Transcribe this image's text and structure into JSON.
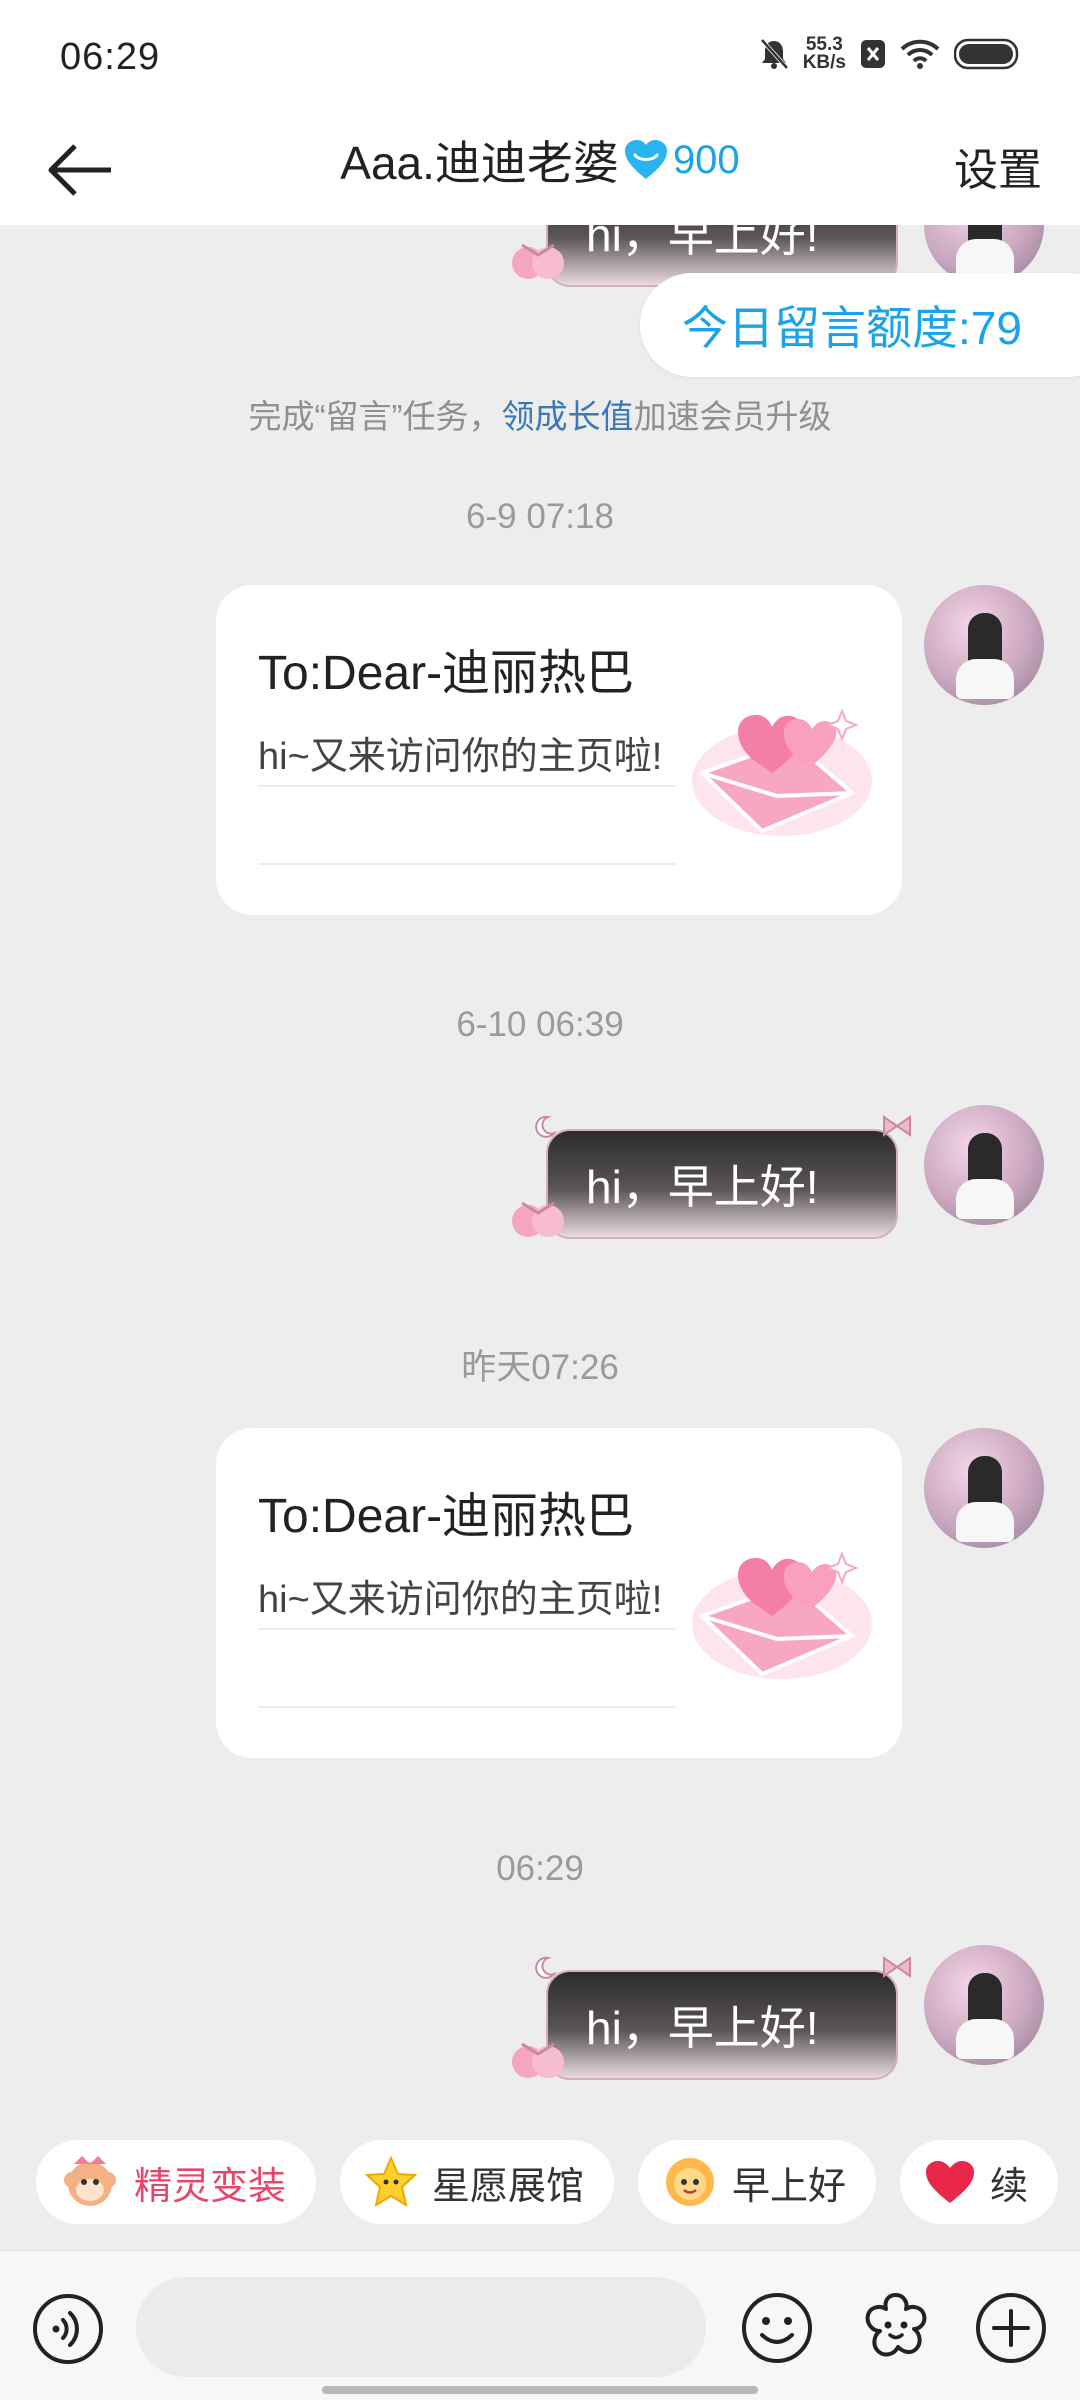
{
  "status_bar": {
    "time": "06:29",
    "net_speed_value": "55.3",
    "net_speed_unit": "KB/s",
    "icons": [
      "mute-bell-icon",
      "close-box-icon",
      "wifi-icon",
      "battery-icon"
    ]
  },
  "header": {
    "back_icon": "arrow-left-icon",
    "title": "Aaa.迪迪老婆",
    "level_icon": "blue-heart-icon",
    "level_value": "900",
    "settings_label": "设置"
  },
  "chat": {
    "quota_text": "今日留言额度:79",
    "task_tip": {
      "prefix": "完成“留言”任务，",
      "link": "领成长值",
      "suffix": "加速会员升级"
    },
    "top_partial_bubble_text": "hi，早上好!",
    "messages": [
      {
        "time": "6-9 07:18",
        "type": "card",
        "to": "To:Dear-迪丽热巴",
        "body": "hi~又来访问你的主页啦!"
      },
      {
        "time": "6-10 06:39",
        "type": "bubble",
        "text": "hi，早上好!"
      },
      {
        "time": "昨天07:26",
        "type": "card",
        "to": "To:Dear-迪丽热巴",
        "body": "hi~又来访问你的主页啦!"
      },
      {
        "time": "06:29",
        "type": "bubble",
        "text": "hi，早上好!"
      }
    ]
  },
  "quick_chips": [
    {
      "label": "精灵变装",
      "icon": "monkey-face-icon"
    },
    {
      "label": "星愿展馆",
      "icon": "star-face-icon"
    },
    {
      "label": "早上好",
      "icon": "sun-face-icon"
    },
    {
      "label": "续",
      "icon": "heart-icon"
    }
  ],
  "input_bar": {
    "placeholder": "",
    "voice_icon": "voice-icon",
    "emoji_icon": "smile-icon",
    "flower_icon": "flower-icon",
    "plus_icon": "plus-circle-icon"
  },
  "colors": {
    "accent_blue": "#1aa3e8",
    "link_blue": "#3a78b8",
    "chip_pink": "#e8456b",
    "background": "#ededed"
  }
}
